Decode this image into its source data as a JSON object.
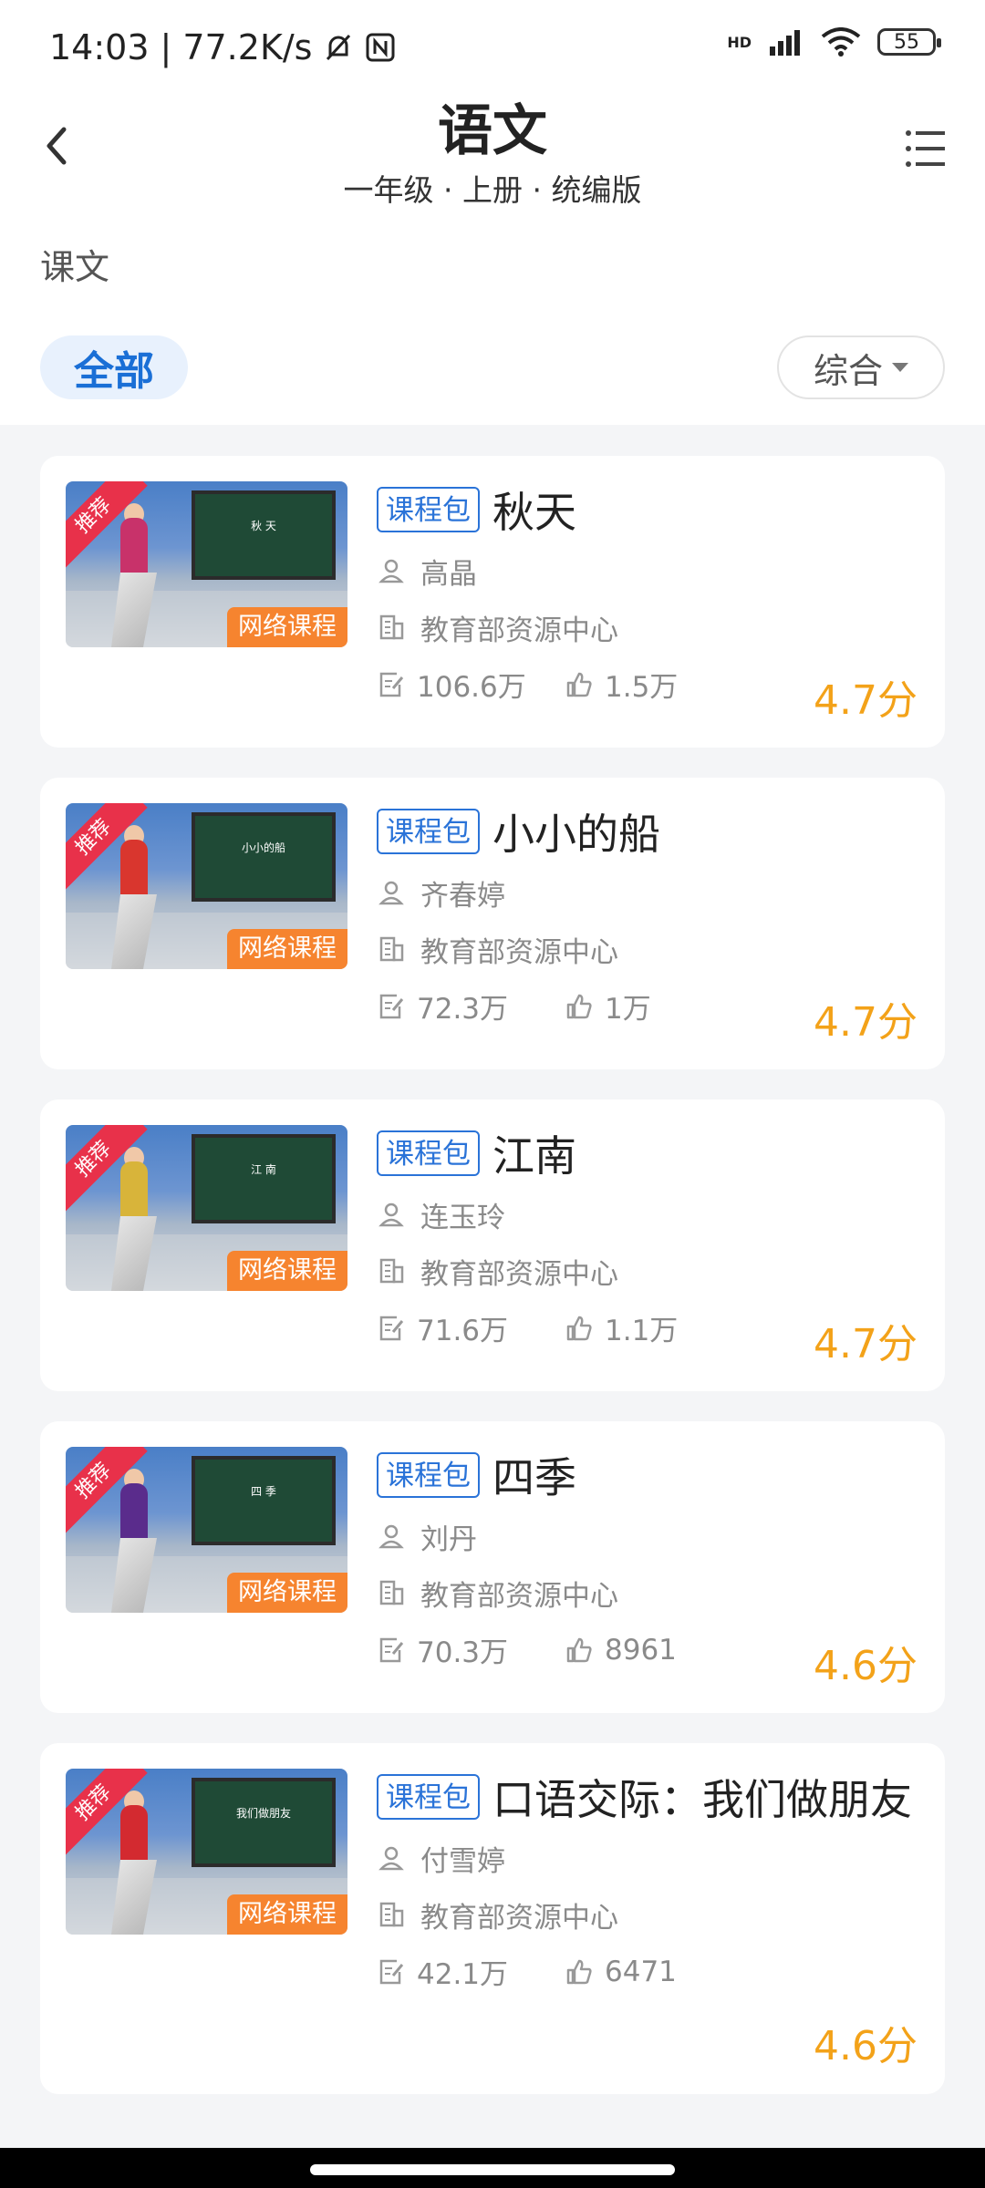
{
  "status_bar": {
    "time": "14:03",
    "speed": "77.2K/s",
    "battery": "55",
    "hd_label": "HD"
  },
  "header": {
    "title": "语文",
    "subtitle": "一年级 · 上册 · 统编版"
  },
  "section": {
    "label": "课文"
  },
  "filters": {
    "all_label": "全部",
    "sort_label": "综合"
  },
  "thumb_labels": {
    "recommend": "推荐",
    "net_course": "网络课程"
  },
  "courses": [
    {
      "badge": "课程包",
      "title": "秋天",
      "teacher": "高晶",
      "org": "教育部资源中心",
      "views": "106.6万",
      "likes": "1.5万",
      "rating": "4.7分",
      "board_text": "秋 天",
      "person_color": "#c8326a"
    },
    {
      "badge": "课程包",
      "title": "小小的船",
      "teacher": "齐春婷",
      "org": "教育部资源中心",
      "views": "72.3万",
      "likes": "1万",
      "rating": "4.7分",
      "board_text": "小小的船",
      "person_color": "#d9362e"
    },
    {
      "badge": "课程包",
      "title": "江南",
      "teacher": "连玉玲",
      "org": "教育部资源中心",
      "views": "71.6万",
      "likes": "1.1万",
      "rating": "4.7分",
      "board_text": "江 南",
      "person_color": "#d8b43a"
    },
    {
      "badge": "课程包",
      "title": "四季",
      "teacher": "刘丹",
      "org": "教育部资源中心",
      "views": "70.3万",
      "likes": "8961",
      "rating": "4.6分",
      "board_text": "四 季",
      "person_color": "#5a2c8c"
    },
    {
      "badge": "课程包",
      "title": "口语交际：我们做朋友",
      "teacher": "付雪婷",
      "org": "教育部资源中心",
      "views": "42.1万",
      "likes": "6471",
      "rating": "4.6分",
      "board_text": "我们做朋友",
      "person_color": "#d32a30"
    }
  ]
}
